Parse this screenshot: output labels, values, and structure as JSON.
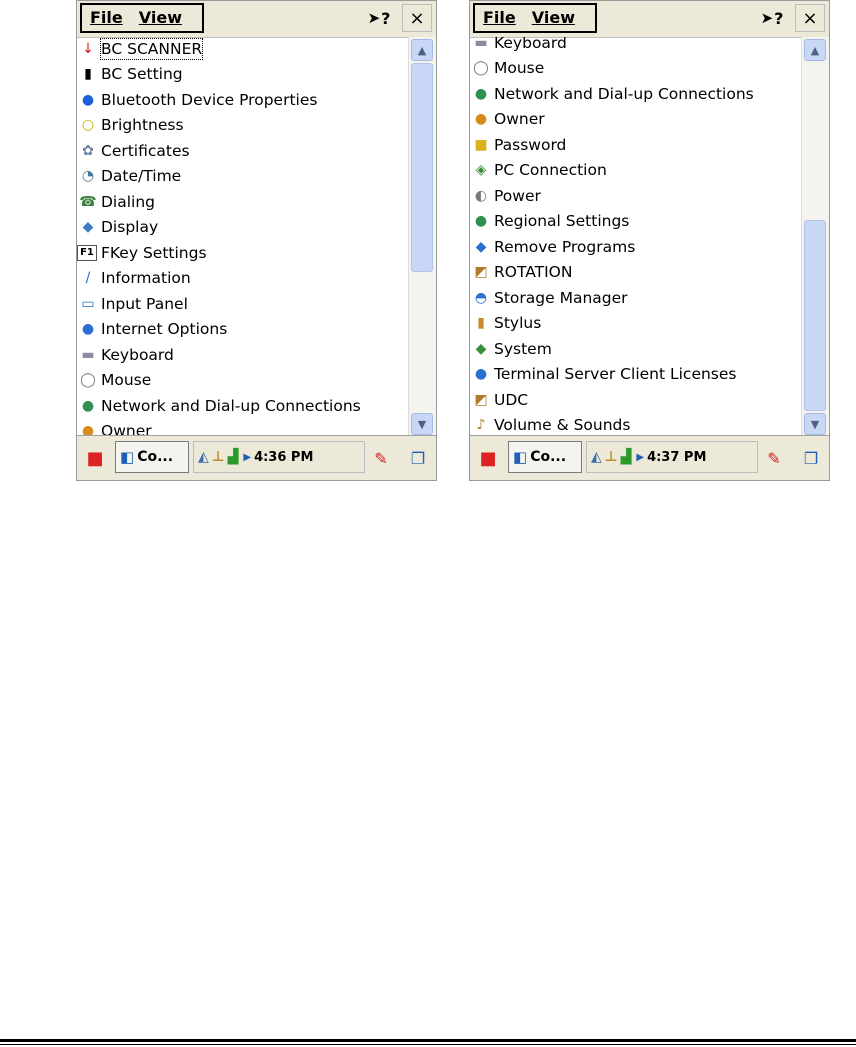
{
  "menu": {
    "file": "File",
    "view": "View",
    "help": "?",
    "close": "×"
  },
  "taskbar": {
    "button_label": "Co..."
  },
  "screens": [
    {
      "time": "4:36 PM",
      "items": [
        {
          "label": "BC SCANNER",
          "icon": "↓",
          "icon_name": "bc-scanner-icon",
          "color": "#d42020",
          "selected": true
        },
        {
          "label": "BC Setting",
          "icon": "▮",
          "icon_name": "barcode-icon",
          "color": "#000000"
        },
        {
          "label": "Bluetooth Device Properties",
          "icon": "●",
          "icon_name": "bluetooth-icon",
          "color": "#1d5fd6"
        },
        {
          "label": "Brightness",
          "icon": "○",
          "icon_name": "bulb-icon",
          "color": "#c7b400"
        },
        {
          "label": "Certificates",
          "icon": "✿",
          "icon_name": "certificate-icon",
          "color": "#6b7fa6"
        },
        {
          "label": "Date/Time",
          "icon": "◔",
          "icon_name": "clock-icon",
          "color": "#447799"
        },
        {
          "label": "Dialing",
          "icon": "☎",
          "icon_name": "phone-icon",
          "color": "#3a7f3a"
        },
        {
          "label": "Display",
          "icon": "◆",
          "icon_name": "display-icon",
          "color": "#3c7cc0"
        },
        {
          "label": "FKey Settings",
          "icon": "F1",
          "icon_name": "fkey-icon",
          "color": "#000000"
        },
        {
          "label": "Information",
          "icon": "/",
          "icon_name": "information-icon",
          "color": "#2a6fd1"
        },
        {
          "label": "Input Panel",
          "icon": "▭",
          "icon_name": "keyboard-panel-icon",
          "color": "#2a6fd1"
        },
        {
          "label": "Internet Options",
          "icon": "●",
          "icon_name": "globe-icon",
          "color": "#2a6fd1"
        },
        {
          "label": "Keyboard",
          "icon": "▬",
          "icon_name": "keyboard-icon",
          "color": "#8a8aa0"
        },
        {
          "label": "Mouse",
          "icon": "◯",
          "icon_name": "mouse-icon",
          "color": "#777777"
        },
        {
          "label": "Network and Dial-up Connections",
          "icon": "●",
          "icon_name": "network-icon",
          "color": "#2f8f4f"
        },
        {
          "label": "Owner",
          "icon": "●",
          "icon_name": "owner-icon",
          "color": "#d98a1a"
        }
      ],
      "scroll": {
        "thumb_start": 0.0,
        "thumb_end": 0.6
      }
    },
    {
      "time": "4:37 PM",
      "items": [
        {
          "label": "Keyboard",
          "icon": "▬",
          "icon_name": "keyboard-icon",
          "color": "#8a8aa0"
        },
        {
          "label": "Mouse",
          "icon": "◯",
          "icon_name": "mouse-icon",
          "color": "#777777"
        },
        {
          "label": "Network and Dial-up Connections",
          "icon": "●",
          "icon_name": "network-icon",
          "color": "#2f8f4f"
        },
        {
          "label": "Owner",
          "icon": "●",
          "icon_name": "owner-icon",
          "color": "#d98a1a"
        },
        {
          "label": "Password",
          "icon": "■",
          "icon_name": "lock-icon",
          "color": "#d9b21a"
        },
        {
          "label": "PC Connection",
          "icon": "◈",
          "icon_name": "pc-connection-icon",
          "color": "#3a8f3a"
        },
        {
          "label": "Power",
          "icon": "◐",
          "icon_name": "power-icon",
          "color": "#777777"
        },
        {
          "label": "Regional Settings",
          "icon": "●",
          "icon_name": "regional-icon",
          "color": "#2f8f4f"
        },
        {
          "label": "Remove Programs",
          "icon": "◆",
          "icon_name": "remove-programs-icon",
          "color": "#2a6fd1"
        },
        {
          "label": "ROTATION",
          "icon": "◩",
          "icon_name": "rotation-icon",
          "color": "#b07a2a"
        },
        {
          "label": "Storage Manager",
          "icon": "◓",
          "icon_name": "storage-icon",
          "color": "#2a6fd1"
        },
        {
          "label": "Stylus",
          "icon": "▮",
          "icon_name": "stylus-icon",
          "color": "#c78a2a"
        },
        {
          "label": "System",
          "icon": "◆",
          "icon_name": "system-icon",
          "color": "#3a8f3a"
        },
        {
          "label": "Terminal Server Client Licenses",
          "icon": "●",
          "icon_name": "terminal-server-icon",
          "color": "#2a6fd1"
        },
        {
          "label": "UDC",
          "icon": "◩",
          "icon_name": "udc-icon",
          "color": "#b07a2a"
        },
        {
          "label": "Volume & Sounds",
          "icon": "♪",
          "icon_name": "volume-icon",
          "color": "#b07a2a"
        }
      ],
      "scroll": {
        "thumb_start": 0.45,
        "thumb_end": 1.0
      }
    }
  ]
}
